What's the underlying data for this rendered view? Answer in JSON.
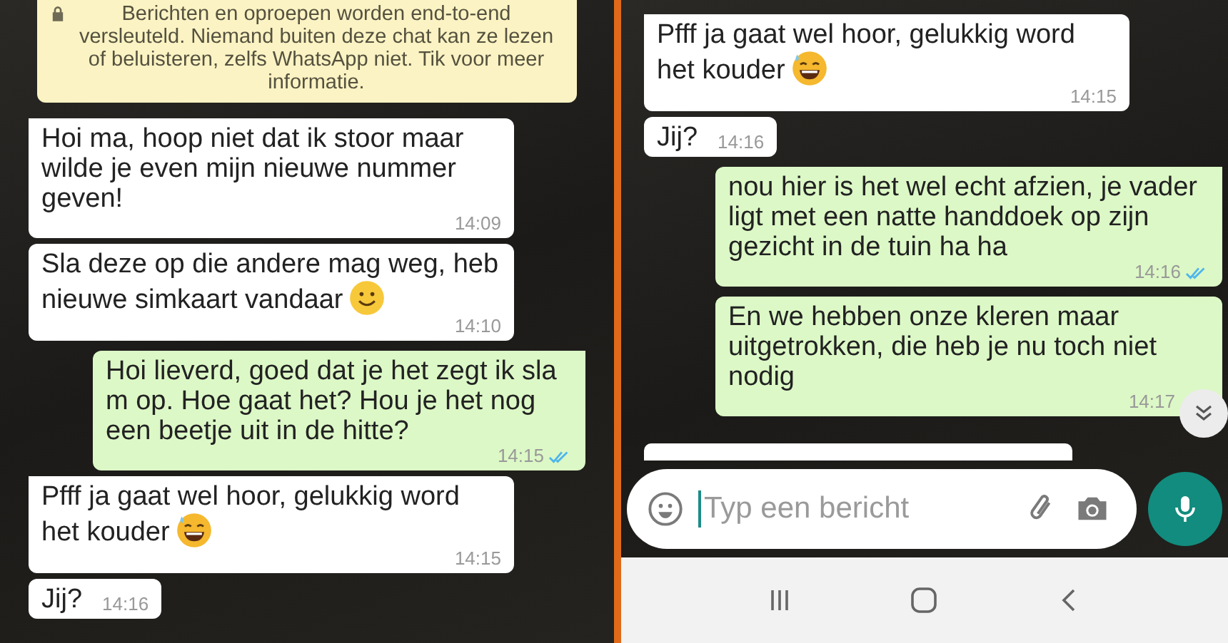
{
  "left_screen": {
    "notice": {
      "text": "Berichten en oproepen worden end-to-end versleuteld. Niemand buiten deze chat kan ze lezen of beluisteren, zelfs WhatsApp niet. Tik voor meer informatie."
    },
    "messages": [
      {
        "outgoing": false,
        "kind": "plain",
        "text": "Hoi ma, hoop niet dat ik stoor maar wilde je even mijn nieuwe nummer geven!",
        "time": "14:09",
        "tail": true
      },
      {
        "outgoing": false,
        "kind": "smiley",
        "text": "Sla deze op die andere mag weg, heb nieuwe simkaart vandaar",
        "time": "14:10",
        "tail": false
      },
      {
        "outgoing": true,
        "kind": "plain",
        "text": "Hoi lieverd, goed dat je het zegt ik sla m op. Hoe gaat het? Hou je het nog een beetje uit in de hitte?",
        "time": "14:15",
        "read": true,
        "tail": true
      },
      {
        "outgoing": false,
        "kind": "laughing",
        "text": "Pfff ja gaat wel hoor, gelukkig word het kouder",
        "time": "14:15",
        "tail": true
      },
      {
        "outgoing": false,
        "kind": "plain",
        "text": "Jij?",
        "time": "14:16",
        "tail": false
      }
    ]
  },
  "right_screen": {
    "messages": [
      {
        "outgoing": false,
        "kind": "laughing",
        "text": "Pfff ja gaat wel hoor, gelukkig word het kouder",
        "time": "14:15",
        "tail": true
      },
      {
        "outgoing": false,
        "kind": "plain",
        "text": "Jij?",
        "time": "14:16",
        "tail": false
      },
      {
        "outgoing": true,
        "kind": "plain",
        "text": "nou hier is het wel echt afzien, je vader ligt met een natte handdoek op zijn gezicht in de tuin ha ha",
        "time": "14:16",
        "read": true,
        "tail": true
      },
      {
        "outgoing": true,
        "kind": "plain",
        "text": "En we hebben onze kleren maar uitgetrokken, die heb je nu toch niet nodig",
        "time": "14:17",
        "tail": false
      }
    ],
    "composer": {
      "placeholder": "Typ een bericht"
    }
  }
}
